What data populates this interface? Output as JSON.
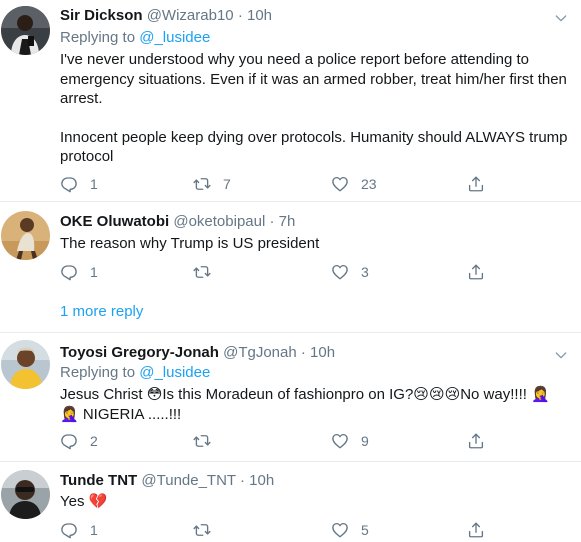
{
  "tweets": [
    {
      "name": "Sir Dickson",
      "handle": "@Wizarab10",
      "dot": "·",
      "time": "10h",
      "replying_prefix": "Replying to ",
      "replying_handle": "@_lusidee",
      "paragraphs": [
        "I've never understood why you need a police report before attending to emergency situations. Even if it was an armed robber, treat him/her first then arrest.",
        "Innocent people keep dying over protocols. Humanity should ALWAYS trump protocol"
      ],
      "reply_count": "1",
      "retweet_count": "7",
      "like_count": "23"
    },
    {
      "name": "OKE Oluwatobi",
      "handle": "@oketobipaul",
      "dot": "·",
      "time": "7h",
      "text": "The reason why Trump is US president",
      "reply_count": "1",
      "retweet_count": "",
      "like_count": "3"
    },
    {
      "name": "Toyosi Gregory-Jonah",
      "handle": "@TgJonah",
      "dot": "·",
      "time": "10h",
      "replying_prefix": "Replying to ",
      "replying_handle": "@_lusidee",
      "line1": "Jesus Christ 😳Is this Moradeun of fashionpro on IG?😢😢😢No way!!!! 🤦‍♀️",
      "line2": "🤦‍♀️ NIGERIA .....!!!",
      "reply_count": "2",
      "retweet_count": "",
      "like_count": "9"
    },
    {
      "name": "Tunde TNT",
      "handle": "@Tunde_TNT",
      "dot": "·",
      "time": "10h",
      "text": "Yes 💔",
      "reply_count": "1",
      "retweet_count": "",
      "like_count": "5"
    }
  ],
  "more_replies": "1 more reply",
  "colors": {
    "link": "#1da1f2",
    "muted": "#657786",
    "text": "#14171a",
    "divider": "#e6ecf0"
  },
  "icons": [
    "reply-icon",
    "retweet-icon",
    "like-icon",
    "share-icon",
    "caret-down-icon"
  ]
}
